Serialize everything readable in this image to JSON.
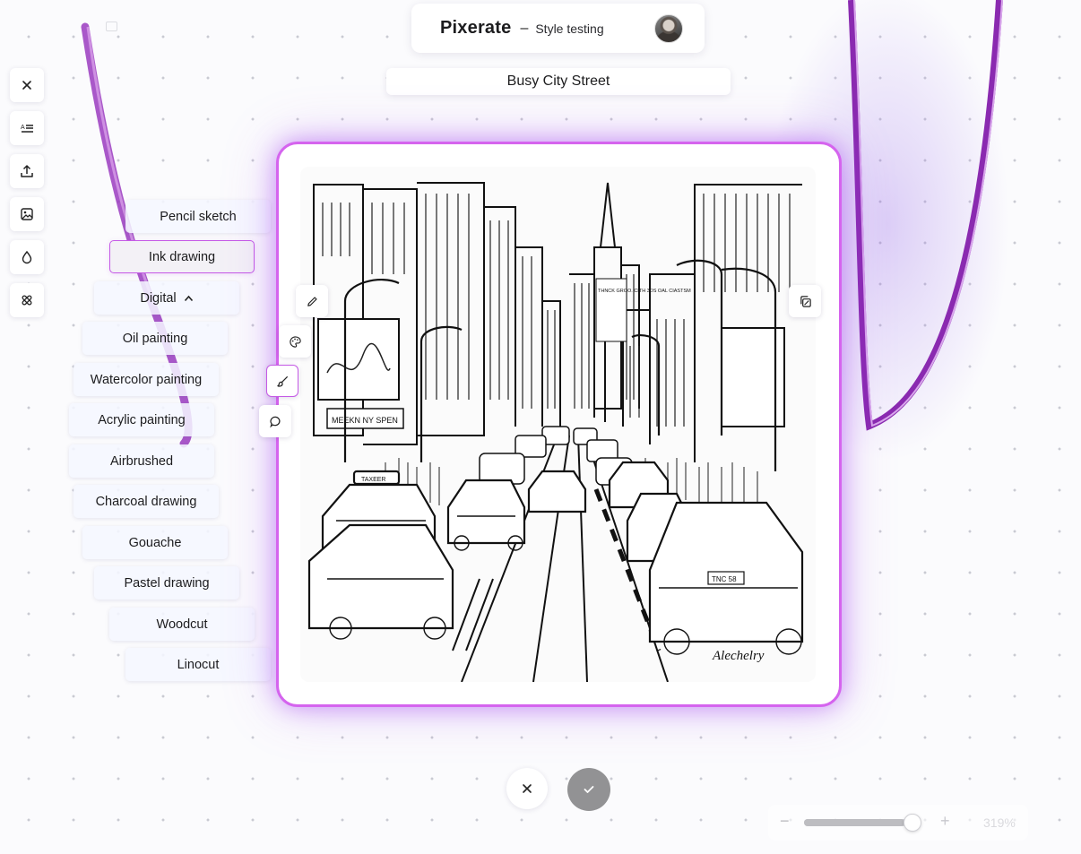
{
  "header": {
    "app_name": "Pixerate",
    "separator": "–",
    "subtitle": "Style testing",
    "avatar_icon": "user-avatar"
  },
  "prompt": {
    "value": "Busy City Street"
  },
  "toolbar": {
    "items": [
      {
        "icon": "close-icon"
      },
      {
        "icon": "text-align-icon"
      },
      {
        "icon": "upload-icon"
      },
      {
        "icon": "image-icon"
      },
      {
        "icon": "drop-icon"
      },
      {
        "icon": "magic-wand-icon"
      }
    ]
  },
  "styles": {
    "items": [
      {
        "label": "Pencil sketch",
        "selected": false
      },
      {
        "label": "Ink drawing",
        "selected": true
      },
      {
        "label": "Digital",
        "expanded": true
      },
      {
        "label": "Oil painting"
      },
      {
        "label": "Watercolor painting"
      },
      {
        "label": "Acrylic painting"
      },
      {
        "label": "Airbrushed"
      },
      {
        "label": "Charcoal drawing"
      },
      {
        "label": "Gouache"
      },
      {
        "label": "Pastel drawing"
      },
      {
        "label": "Woodcut"
      },
      {
        "label": "Linocut"
      }
    ]
  },
  "canvas": {
    "side_tools": [
      {
        "icon": "pen-icon"
      },
      {
        "icon": "palette-icon"
      },
      {
        "icon": "brush-icon",
        "active": true
      },
      {
        "icon": "comment-icon"
      }
    ],
    "corner_tool": {
      "icon": "copy-image-icon"
    },
    "image_signature": "Alechelry",
    "image_signs": {
      "left_sign": "MEEKN NY SPEN",
      "taxi_sign": "TAXEER",
      "center_sign": "THNCK GROO. CITH 3DS OAL CIASTSM",
      "plate": "TNC 58"
    }
  },
  "actions": {
    "cancel_icon": "close-icon",
    "confirm_icon": "check-icon"
  },
  "zoom": {
    "minus": "−",
    "plus": "+",
    "value": "319%",
    "slider_level": 0.9
  },
  "colors": {
    "accent": "#d564ee",
    "accent_dark": "#8a2ab0"
  }
}
